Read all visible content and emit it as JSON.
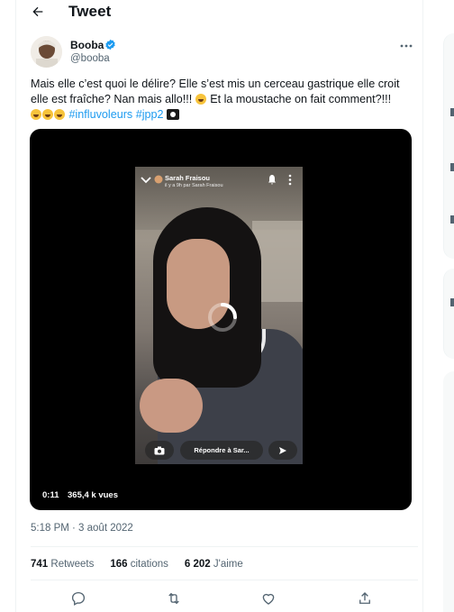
{
  "header": {
    "title": "Tweet",
    "back_icon": "arrow-left-icon"
  },
  "author": {
    "name": "Booba",
    "handle": "@booba",
    "verified": true,
    "verified_color": "#1d9bf0"
  },
  "tweet": {
    "text_part1": "Mais elle c’est quoi le délire? Elle s’est mis un cerceau gastrique elle croit elle est fraîche? Nan mais allo!!!",
    "text_part2": "Et la moustache on fait comment?!!!",
    "hashtags": [
      "#influvoleurs",
      "#jpp2"
    ],
    "emojis": [
      "rolling-on-floor-laughing",
      "pirate-flag"
    ]
  },
  "video": {
    "time": "0:11",
    "views": "365,4 k vues",
    "snap_name": "Sarah Fraisou",
    "snap_sub": "il y a 9h par Sarah Fraisou",
    "reply_placeholder": "Répondre à Sar..."
  },
  "meta": {
    "timestamp": "5:18 PM · 3 août 2022"
  },
  "stats": {
    "retweets_count": "741",
    "retweets_label": "Retweets",
    "quotes_count": "166",
    "quotes_label": "citations",
    "likes_count": "6 202",
    "likes_label": "J'aime"
  },
  "actions": [
    "reply-icon",
    "retweet-icon",
    "like-icon",
    "share-icon"
  ],
  "colors": {
    "accent": "#1d9bf0",
    "text": "#0f1419",
    "muted": "#536471",
    "border": "#eff3f4"
  }
}
